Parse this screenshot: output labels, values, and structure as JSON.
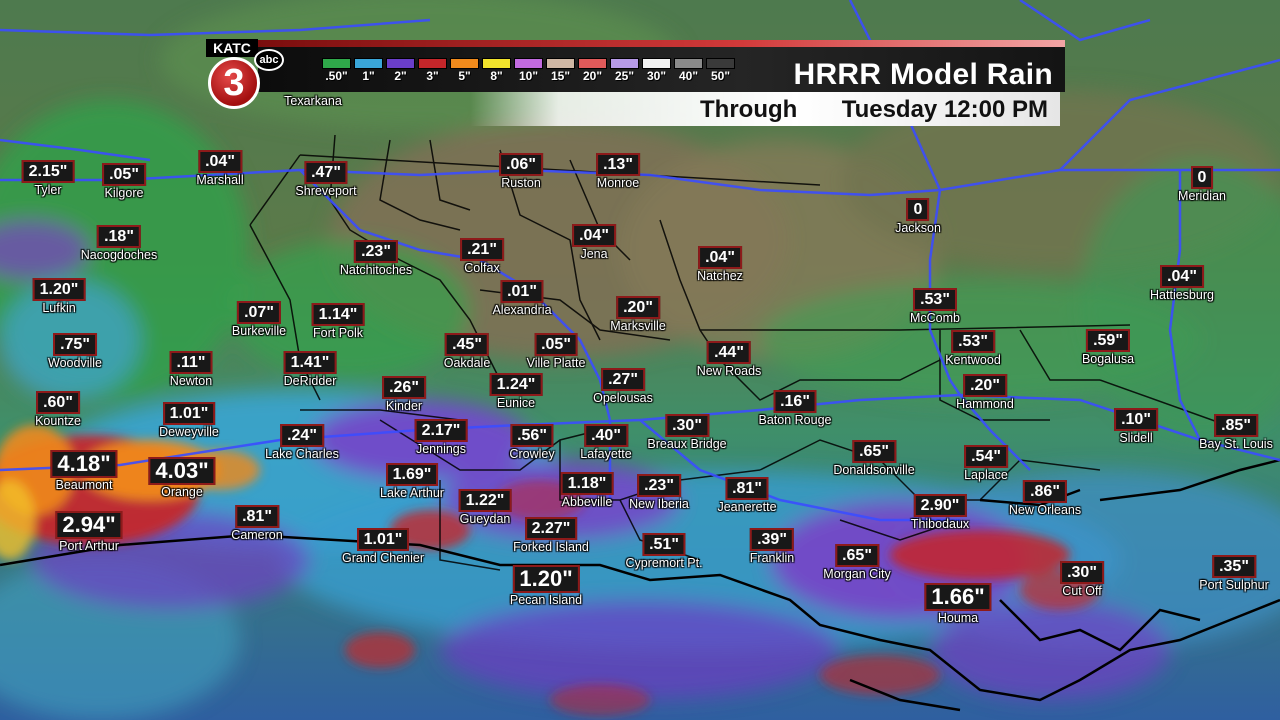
{
  "header": {
    "title": "HRRR Model Rain",
    "through_label": "Through",
    "valid_time": "Tuesday 12:00 PM"
  },
  "logo": {
    "call_letters": "KATC",
    "channel": "3",
    "network": "abc"
  },
  "legend": [
    {
      "label": ".50\"",
      "color": "#2fa84a"
    },
    {
      "label": "1\"",
      "color": "#3aa6d8"
    },
    {
      "label": "2\"",
      "color": "#6a3ec9"
    },
    {
      "label": "3\"",
      "color": "#c4262a"
    },
    {
      "label": "5\"",
      "color": "#f08a1c"
    },
    {
      "label": "8\"",
      "color": "#f2e32c"
    },
    {
      "label": "10\"",
      "color": "#c26be0"
    },
    {
      "label": "15\"",
      "color": "#cfb7a4"
    },
    {
      "label": "20\"",
      "color": "#e05a5a"
    },
    {
      "label": "25\"",
      "color": "#b79be8"
    },
    {
      "label": "30\"",
      "color": "#f2f2f2"
    },
    {
      "label": "40\"",
      "color": "#8a8a8a"
    },
    {
      "label": "50\"",
      "color": "#3a3a3a"
    }
  ],
  "cities": [
    {
      "name": "Texarkana",
      "value": ""
    },
    {
      "name": "Tyler",
      "value": "2.15\""
    },
    {
      "name": "Kilgore",
      "value": ".05\""
    },
    {
      "name": "Marshall",
      "value": ".04\""
    },
    {
      "name": "Shreveport",
      "value": ".47\""
    },
    {
      "name": "Ruston",
      "value": ".06\""
    },
    {
      "name": "Monroe",
      "value": ".13\""
    },
    {
      "name": "Meridian",
      "value": "0"
    },
    {
      "name": "Jackson",
      "value": "0"
    },
    {
      "name": "Nacogdoches",
      "value": ".18\""
    },
    {
      "name": "Natchitoches",
      "value": ".23\""
    },
    {
      "name": "Colfax",
      "value": ".21\""
    },
    {
      "name": "Jena",
      "value": ".04\""
    },
    {
      "name": "Natchez",
      "value": ".04\""
    },
    {
      "name": "Hattiesburg",
      "value": ".04\""
    },
    {
      "name": "Lufkin",
      "value": "1.20\""
    },
    {
      "name": "Alexandria",
      "value": ".01\""
    },
    {
      "name": "McComb",
      "value": ".53\""
    },
    {
      "name": "Burkeville",
      "value": ".07\""
    },
    {
      "name": "Fort Polk",
      "value": "1.14\""
    },
    {
      "name": "Marksville",
      "value": ".20\""
    },
    {
      "name": "Woodville",
      "value": ".75\""
    },
    {
      "name": "Oakdale",
      "value": ".45\""
    },
    {
      "name": "Ville Platte",
      "value": ".05\""
    },
    {
      "name": "New Roads",
      "value": ".44\""
    },
    {
      "name": "Kentwood",
      "value": ".53\""
    },
    {
      "name": "Bogalusa",
      "value": ".59\""
    },
    {
      "name": "Newton",
      "value": ".11\""
    },
    {
      "name": "DeRidder",
      "value": "1.41\""
    },
    {
      "name": "Opelousas",
      "value": ".27\""
    },
    {
      "name": "Kinder",
      "value": ".26\""
    },
    {
      "name": "Eunice",
      "value": "1.24\""
    },
    {
      "name": "Hammond",
      "value": ".20\""
    },
    {
      "name": "Kountze",
      "value": ".60\""
    },
    {
      "name": "Baton Rouge",
      "value": ".16\""
    },
    {
      "name": "Deweyville",
      "value": "1.01\""
    },
    {
      "name": "Slidell",
      "value": ".10\""
    },
    {
      "name": "Bay St. Louis",
      "value": ".85\""
    },
    {
      "name": "Lake Charles",
      "value": ".24\""
    },
    {
      "name": "Jennings",
      "value": "2.17\""
    },
    {
      "name": "Crowley",
      "value": ".56\""
    },
    {
      "name": "Lafayette",
      "value": ".40\""
    },
    {
      "name": "Breaux Bridge",
      "value": ".30\""
    },
    {
      "name": "Donaldsonville",
      "value": ".65\""
    },
    {
      "name": "Laplace",
      "value": ".54\""
    },
    {
      "name": "Beaumont",
      "value": "4.18\""
    },
    {
      "name": "Orange",
      "value": "4.03\""
    },
    {
      "name": "Lake Arthur",
      "value": "1.69\""
    },
    {
      "name": "Abbeville",
      "value": "1.18\""
    },
    {
      "name": "New Iberia",
      "value": ".23\""
    },
    {
      "name": "Jeanerette",
      "value": ".81\""
    },
    {
      "name": "New Orleans",
      "value": ".86\""
    },
    {
      "name": "Gueydan",
      "value": "1.22\""
    },
    {
      "name": "Thibodaux",
      "value": "2.90\""
    },
    {
      "name": "Port Arthur",
      "value": "2.94\""
    },
    {
      "name": "Cameron",
      "value": ".81\""
    },
    {
      "name": "Forked Island",
      "value": "2.27\""
    },
    {
      "name": "Grand Chenier",
      "value": "1.01\""
    },
    {
      "name": "Cypremort Pt.",
      "value": ".51\""
    },
    {
      "name": "Franklin",
      "value": ".39\""
    },
    {
      "name": "Morgan City",
      "value": ".65\""
    },
    {
      "name": "Cut Off",
      "value": ".30\""
    },
    {
      "name": "Port Sulphur",
      "value": ".35\""
    },
    {
      "name": "Pecan Island",
      "value": "1.20\""
    },
    {
      "name": "Houma",
      "value": "1.66\""
    }
  ]
}
